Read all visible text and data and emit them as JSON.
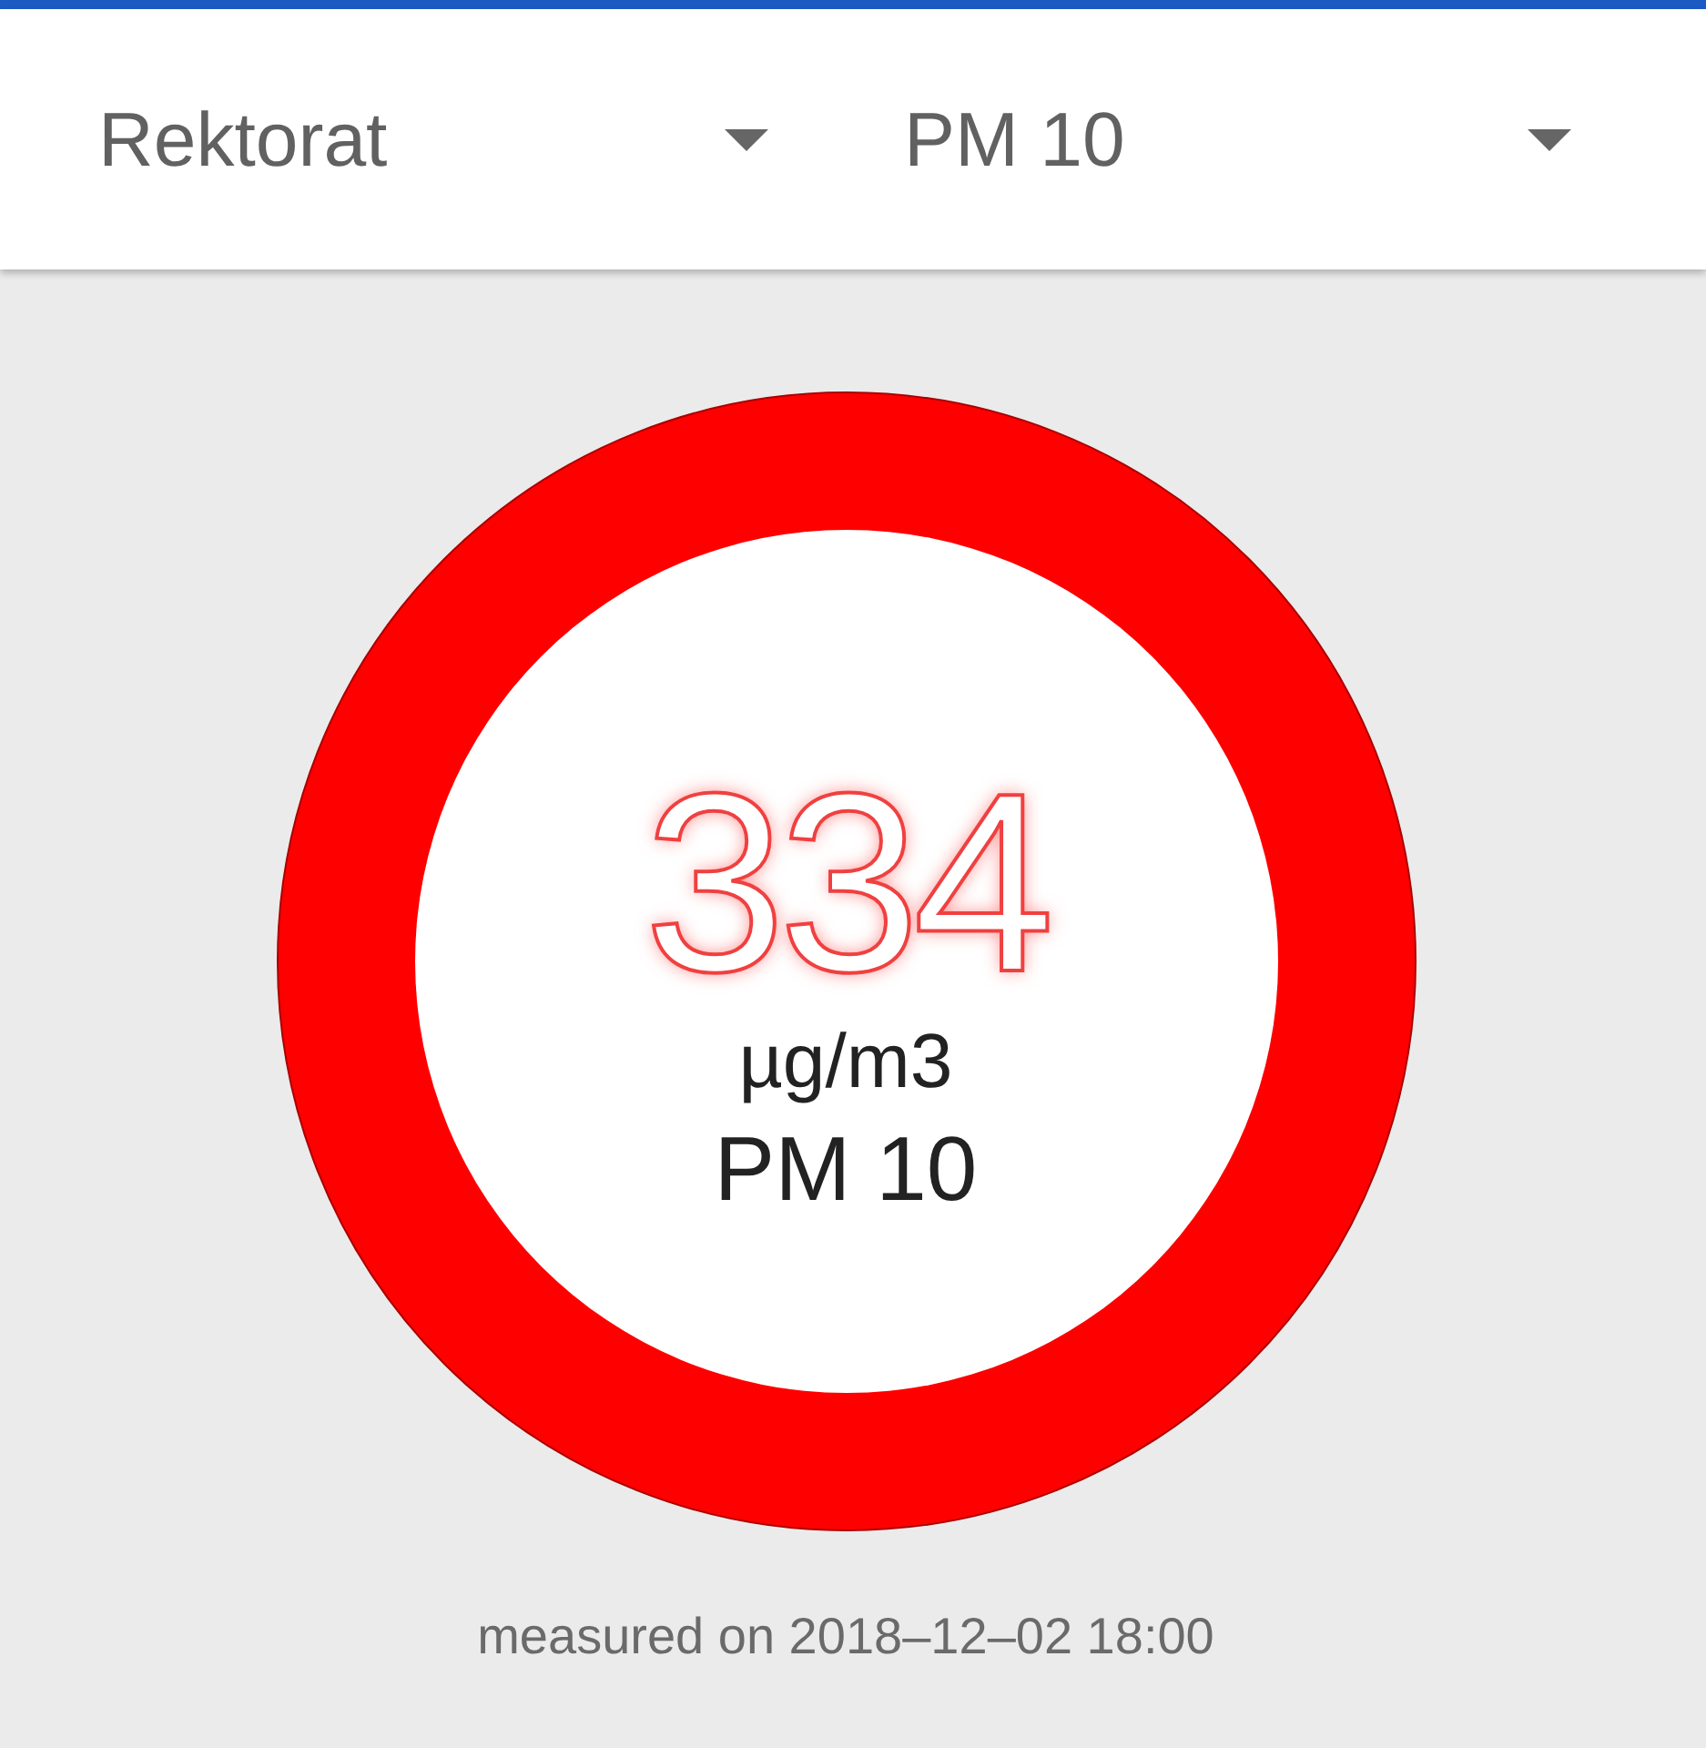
{
  "selectors": [
    {
      "value": "Rektorat"
    },
    {
      "value": "PM 10"
    }
  ],
  "gauge": {
    "value": "334",
    "unit": "µg/m3",
    "pollutant": "PM 10"
  },
  "footer": "measured on 2018–12–02 18:00"
}
